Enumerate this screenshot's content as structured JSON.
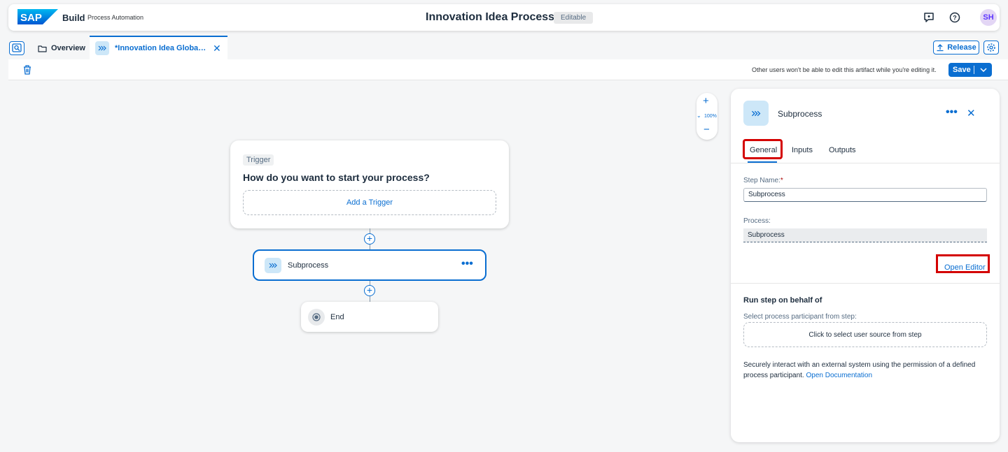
{
  "shell": {
    "logo": "SAP",
    "build": "Build",
    "product": "Process Automation",
    "title": "Innovation Idea Process",
    "badge": "Editable",
    "avatar": "SH"
  },
  "tabs": {
    "overview": "Overview",
    "active": "*Innovation Idea Global Approval",
    "release": "Release"
  },
  "toolbar": {
    "edit_note": "Other users won't be able to edit this artifact while you're editing it.",
    "save": "Save"
  },
  "zoom": {
    "level": "100%"
  },
  "flow": {
    "trigger_tag": "Trigger",
    "trigger_question": "How do you want to start your process?",
    "add_trigger": "Add a Trigger",
    "subprocess_label": "Subprocess",
    "end_label": "End"
  },
  "panel": {
    "title": "Subprocess",
    "tabs": [
      "General",
      "Inputs",
      "Outputs"
    ],
    "step_name_label": "Step Name:",
    "step_name_value": "Subprocess",
    "process_label": "Process:",
    "process_value": "Subprocess",
    "open_editor": "Open Editor",
    "run_title": "Run step on behalf of",
    "select_label": "Select process participant from step:",
    "select_placeholder": "Click to select user source from step",
    "secure_text": "Securely interact with an external system using the permission of a defined process participant.",
    "secure_link": "Open Documentation"
  },
  "colors": {
    "accent": "#0a6ed1",
    "highlight": "#d40000"
  }
}
